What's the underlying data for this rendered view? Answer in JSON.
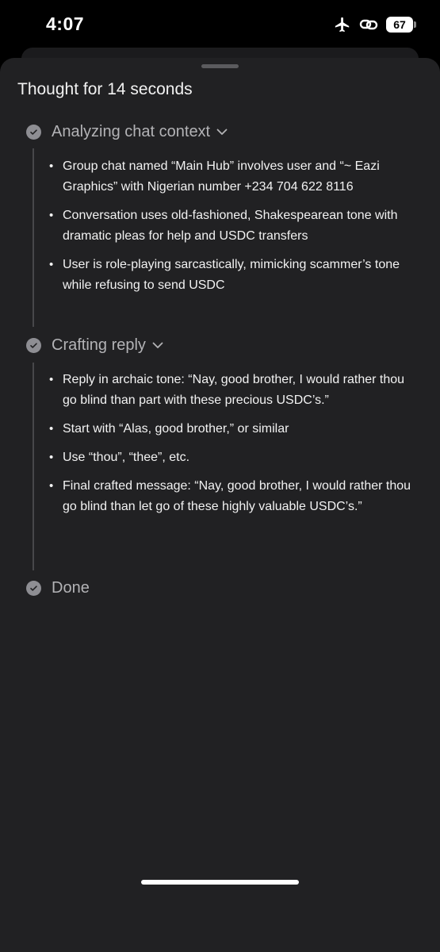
{
  "status_bar": {
    "time": "4:07",
    "icons": [
      "airplane-icon",
      "link-icon"
    ],
    "battery_level": "67"
  },
  "sheet": {
    "title": "Thought for 14 seconds",
    "steps": [
      {
        "label": "Analyzing chat context",
        "icon": "check-icon",
        "expandable": true,
        "bullets": [
          "Group chat named “Main Hub” involves user and “~ Eazi Graphics” with Nigerian number +234 704 622 8116",
          "Conversation uses old-fashioned, Shakespearean tone with dramatic pleas for help and USDC transfers",
          "User is role-playing sarcastically, mimicking scammer’s tone while refusing to send USDC"
        ]
      },
      {
        "label": "Crafting reply",
        "icon": "check-icon",
        "expandable": true,
        "bullets": [
          "Reply in archaic tone: “Nay, good brother, I would rather thou go blind than part with these precious USDC’s.”",
          "Start with “Alas, good brother,” or similar",
          "Use “thou”, “thee”, etc.",
          "Final crafted message: “Nay, good brother, I would rather thou go blind than let go of these highly valuable USDC’s.”"
        ]
      },
      {
        "label": "Done",
        "icon": "check-icon",
        "expandable": false,
        "bullets": []
      }
    ]
  },
  "colors": {
    "sheet_background": "#212123",
    "step_label": "#b3b3b6",
    "check_circle": "#8e8e93",
    "rail": "#47474a"
  }
}
